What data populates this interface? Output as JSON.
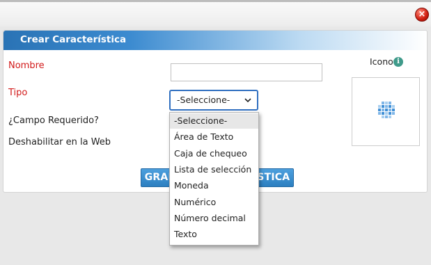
{
  "window": {
    "close_label": "×"
  },
  "form": {
    "title": "Crear Característica",
    "nombre_label": "Nombre",
    "nombre_value": "",
    "tipo_label": "Tipo",
    "tipo_selected": "-Seleccione-",
    "requerido_label": "¿Campo Requerido?",
    "deshabilitar_label": "Deshabilitar en la Web",
    "icono_label": "Icono",
    "info_icon_glyph": "i",
    "save_button_label": "GRABAR CARACTERÍSTICA"
  },
  "dropdown": {
    "options": [
      "-Seleccione-",
      "Área de Texto",
      "Caja de chequeo",
      "Lista de selección",
      "Moneda",
      "Numérico",
      "Número decimal",
      "Texto"
    ]
  },
  "colors": {
    "header_blue": "#2a73b5",
    "required_red": "#d21a1a",
    "button_blue": "#3a8fd0",
    "close_red": "#d01d10"
  }
}
